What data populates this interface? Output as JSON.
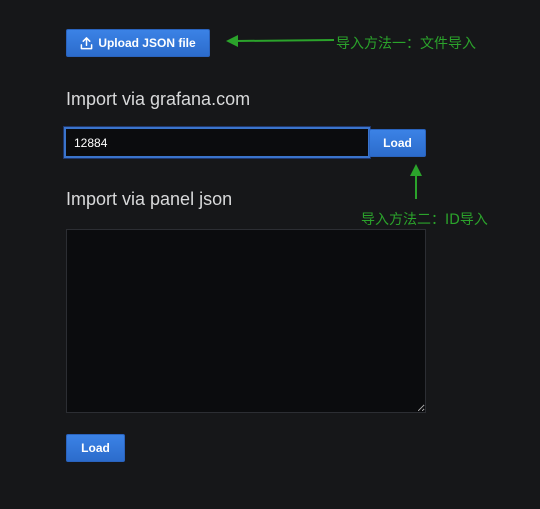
{
  "upload": {
    "label": "Upload JSON file",
    "icon": "upload-icon"
  },
  "grafana_import": {
    "title": "Import via grafana.com",
    "id_value": "12884",
    "load_label": "Load"
  },
  "panel_json_import": {
    "title": "Import via panel json",
    "json_value": "",
    "load_label": "Load"
  },
  "annotations": {
    "file_import": "导入方法一：文件导入",
    "id_import": "导入方法二：ID导入",
    "color": "#2ba32b"
  },
  "colors": {
    "background": "#161719",
    "primary_button": "#3274d9",
    "input_background": "#0b0c0e",
    "input_focus_border": "#3a74cc"
  }
}
